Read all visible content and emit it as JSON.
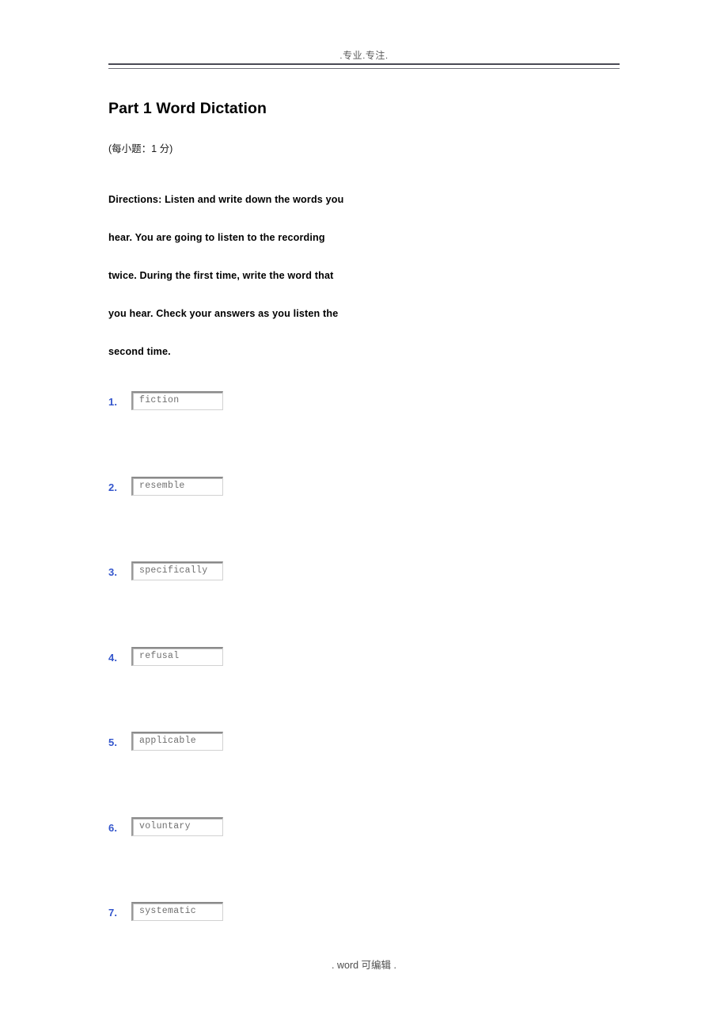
{
  "document": {
    "header_text": ".专业.专注.",
    "footer_text": ".  word 可编辑   .",
    "accent_color": "#3355cc",
    "rule_color": "#4a4a55"
  },
  "title": "Part 1 Word Dictation",
  "score_note": "(每小题：1 分)",
  "directions": {
    "lines": [
      "Directions: Listen and write down the words you",
      "hear. You are going to listen to the recording",
      "twice. During the first time, write the word that",
      "you hear. Check your answers as you listen the",
      "second time."
    ]
  },
  "questions": [
    {
      "number": "1.",
      "value": "fiction",
      "placeholder": ""
    },
    {
      "number": "2.",
      "value": "resemble",
      "placeholder": ""
    },
    {
      "number": "3.",
      "value": "specifically",
      "placeholder": ""
    },
    {
      "number": "4.",
      "value": "refusal",
      "placeholder": ""
    },
    {
      "number": "5.",
      "value": "applicable",
      "placeholder": ""
    },
    {
      "number": "6.",
      "value": "voluntary",
      "placeholder": ""
    },
    {
      "number": "7.",
      "value": "systematic",
      "placeholder": ""
    }
  ]
}
